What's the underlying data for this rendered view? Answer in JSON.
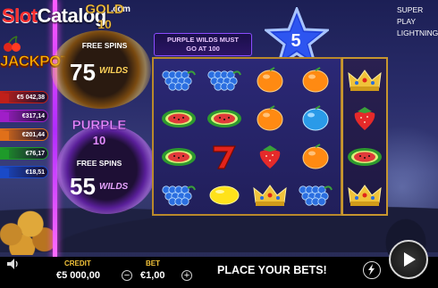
{
  "logo": {
    "slot": "Slot",
    "catalog": "Catalog",
    "dotcom": ".com"
  },
  "jackpot": {
    "title": "JACKPOT",
    "tiers": [
      {
        "value": "€5 042,38",
        "color": "#c0201a"
      },
      {
        "value": "€317,14",
        "color": "#a01ec8"
      },
      {
        "value": "€201,44",
        "color": "#e0701a"
      },
      {
        "value": "€76,17",
        "color": "#1e9a2a"
      },
      {
        "value": "€18,51",
        "color": "#1a4ac8"
      }
    ]
  },
  "bonus_gold": {
    "label": "GOLD",
    "count": "10",
    "free_spins": "FREE SPINS",
    "wilds_num": "75",
    "wilds_label": "WILDS"
  },
  "bonus_purple": {
    "label": "PURPLE",
    "count": "10",
    "free_spins": "FREE SPINS",
    "wilds_num": "55",
    "wilds_label": "WILDS"
  },
  "banner": {
    "line1": "PURPLE WILDS MUST",
    "line2": "GO AT 100"
  },
  "star": {
    "value": "5"
  },
  "top_right": {
    "line1": "SUPER PLAY",
    "line2": "LIGHTNING"
  },
  "reels": [
    [
      "grapes",
      "watermelon",
      "watermelon",
      "grapes"
    ],
    [
      "grapes",
      "watermelon",
      "seven",
      "lemon"
    ],
    [
      "orange",
      "orange",
      "strawberry",
      "crown"
    ],
    [
      "orange",
      "plum",
      "orange",
      "grapes"
    ]
  ],
  "extra_reel": [
    "crown",
    "strawberry",
    "watermelon",
    "crown"
  ],
  "bottom": {
    "credit_label": "CREDIT",
    "credit_value": "€5 000,00",
    "bet_label": "BET",
    "bet_value": "€1,00",
    "minus": "−",
    "plus": "+",
    "message": "PLACE YOUR BETS!"
  },
  "icons": [
    "speaker-icon",
    "autoplay-icon",
    "spin-icon",
    "cherry-icon"
  ]
}
